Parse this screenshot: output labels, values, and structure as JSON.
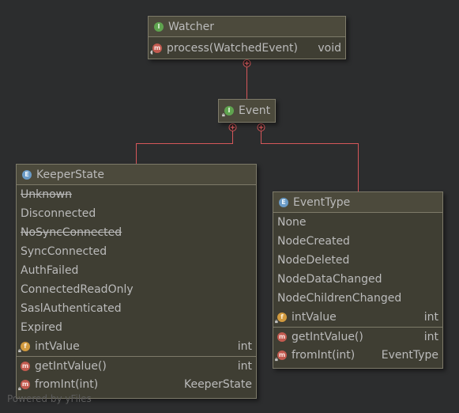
{
  "diagram": {
    "nodes": {
      "watcher": {
        "title": "Watcher",
        "kind_icon": "interface-icon",
        "methods": [
          {
            "name": "process(WatchedEvent)",
            "type": "void",
            "icon": "method-icon"
          }
        ]
      },
      "event": {
        "title": "Event",
        "kind_icon": "interface-icon"
      },
      "keeper_state": {
        "title": "KeeperState",
        "kind_icon": "enum-icon",
        "constants": [
          {
            "name": "Unknown",
            "deprecated": true
          },
          {
            "name": "Disconnected",
            "deprecated": false
          },
          {
            "name": "NoSyncConnected",
            "deprecated": true
          },
          {
            "name": "SyncConnected",
            "deprecated": false
          },
          {
            "name": "AuthFailed",
            "deprecated": false
          },
          {
            "name": "ConnectedReadOnly",
            "deprecated": false
          },
          {
            "name": "SaslAuthenticated",
            "deprecated": false
          },
          {
            "name": "Expired",
            "deprecated": false
          }
        ],
        "fields": [
          {
            "name": "intValue",
            "type": "int",
            "icon": "field-icon"
          }
        ],
        "methods": [
          {
            "name": "getIntValue()",
            "type": "int",
            "icon": "method-icon"
          },
          {
            "name": "fromInt(int)",
            "type": "KeeperState",
            "icon": "method-icon"
          }
        ]
      },
      "event_type": {
        "title": "EventType",
        "kind_icon": "enum-icon",
        "constants": [
          {
            "name": "None"
          },
          {
            "name": "NodeCreated"
          },
          {
            "name": "NodeDeleted"
          },
          {
            "name": "NodeDataChanged"
          },
          {
            "name": "NodeChildrenChanged"
          }
        ],
        "fields": [
          {
            "name": "intValue",
            "type": "int",
            "icon": "field-icon"
          }
        ],
        "methods": [
          {
            "name": "getIntValue()",
            "type": "int",
            "icon": "method-icon"
          },
          {
            "name": "fromInt(int)",
            "type": "EventType",
            "icon": "method-icon"
          }
        ]
      }
    },
    "edges": [
      {
        "from": "event",
        "to": "watcher",
        "relation": "inner-class"
      },
      {
        "from": "keeper_state",
        "to": "event",
        "relation": "inner-class"
      },
      {
        "from": "event_type",
        "to": "event",
        "relation": "inner-class"
      }
    ],
    "colors": {
      "background": "#2c2d2e",
      "node_body": "#3f3e33",
      "node_header": "#4c4a3c",
      "node_border": "#7d7a69",
      "text": "#bbbbbb",
      "edge": "#d6575a"
    },
    "watermark": "Powered by yFiles"
  }
}
